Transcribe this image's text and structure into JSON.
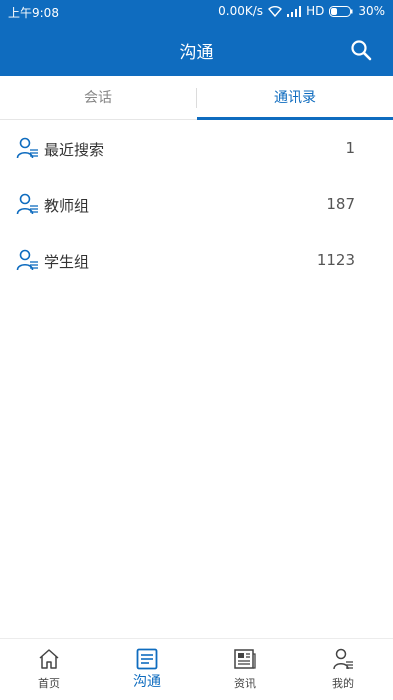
{
  "status_bar": {
    "time": "上午9:08",
    "network_speed": "0.00K/s",
    "network_type": "HD",
    "battery": "30%"
  },
  "header": {
    "title": "沟通",
    "search_icon": "search-icon"
  },
  "tabs": [
    {
      "label": "会话",
      "active": false
    },
    {
      "label": "通讯录",
      "active": true
    }
  ],
  "contacts": [
    {
      "label": "最近搜索",
      "count": "1",
      "icon": "contact-list-icon"
    },
    {
      "label": "教师组",
      "count": "187",
      "icon": "contact-list-icon"
    },
    {
      "label": "学生组",
      "count": "1123",
      "icon": "contact-list-icon"
    }
  ],
  "bottom_nav": [
    {
      "label": "首页",
      "icon": "home-icon",
      "active": false
    },
    {
      "label": "沟通",
      "icon": "chat-icon",
      "active": true
    },
    {
      "label": "资讯",
      "icon": "news-icon",
      "active": false
    },
    {
      "label": "我的",
      "icon": "profile-icon",
      "active": false
    }
  ],
  "colors": {
    "primary": "#0f6cbf",
    "text": "#333333",
    "muted": "#888888"
  }
}
